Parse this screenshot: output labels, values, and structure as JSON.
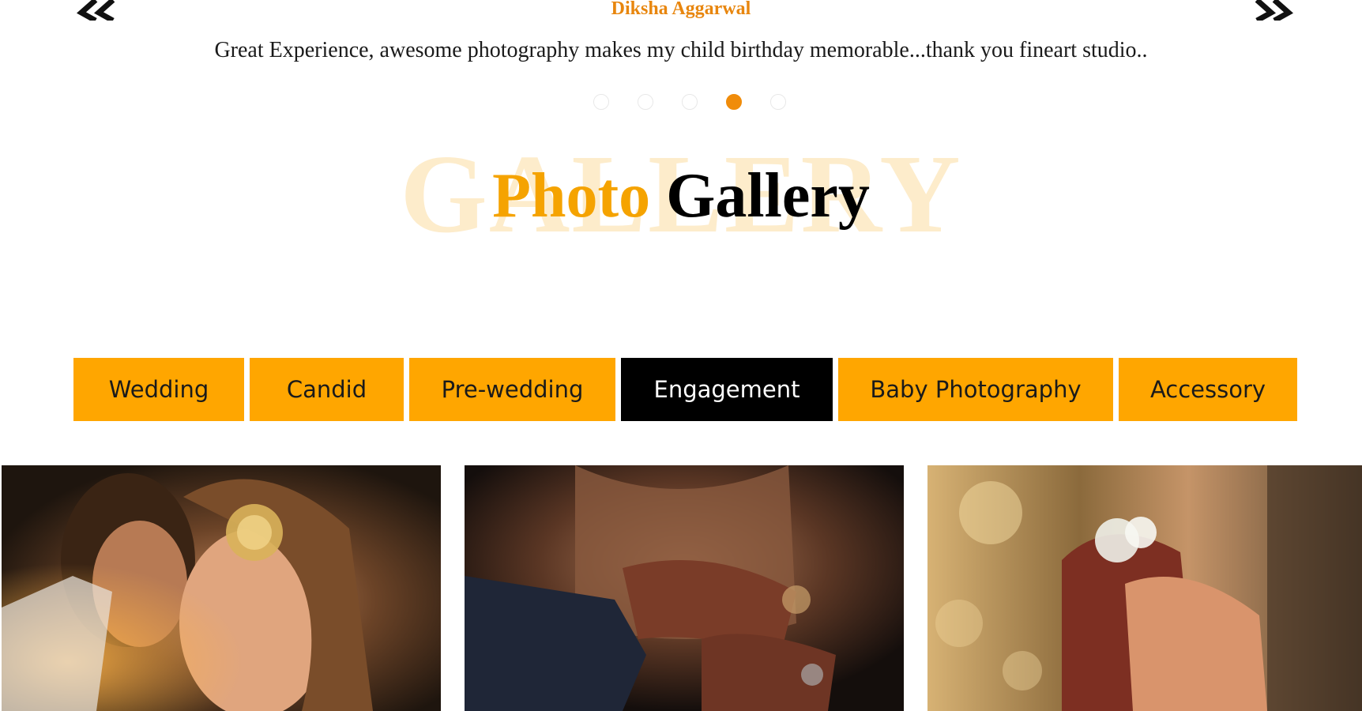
{
  "testimonial": {
    "author": "Diksha Aggarwal",
    "quote": "Great Experience, awesome photography makes my child birthday memorable...thank you fineart studio..",
    "prev_icon": "double-chevron-left-icon",
    "next_icon": "double-chevron-right-icon",
    "dot_count": 5,
    "active_dot": 4
  },
  "gallery": {
    "watermark": "GALLERY",
    "title_part1": "Photo",
    "title_part2": "Gallery",
    "accent_color": "#ffa600",
    "tabs": [
      {
        "label": "Wedding",
        "active": false
      },
      {
        "label": "Candid",
        "active": false
      },
      {
        "label": "Pre-wedding",
        "active": false
      },
      {
        "label": "Engagement",
        "active": true
      },
      {
        "label": "Baby Photography",
        "active": false
      },
      {
        "label": "Accessory",
        "active": false
      }
    ],
    "photos": [
      {
        "subject": "couple-portrait-photo"
      },
      {
        "subject": "mehndi-hands-photo"
      },
      {
        "subject": "holding-hands-photo"
      }
    ]
  }
}
